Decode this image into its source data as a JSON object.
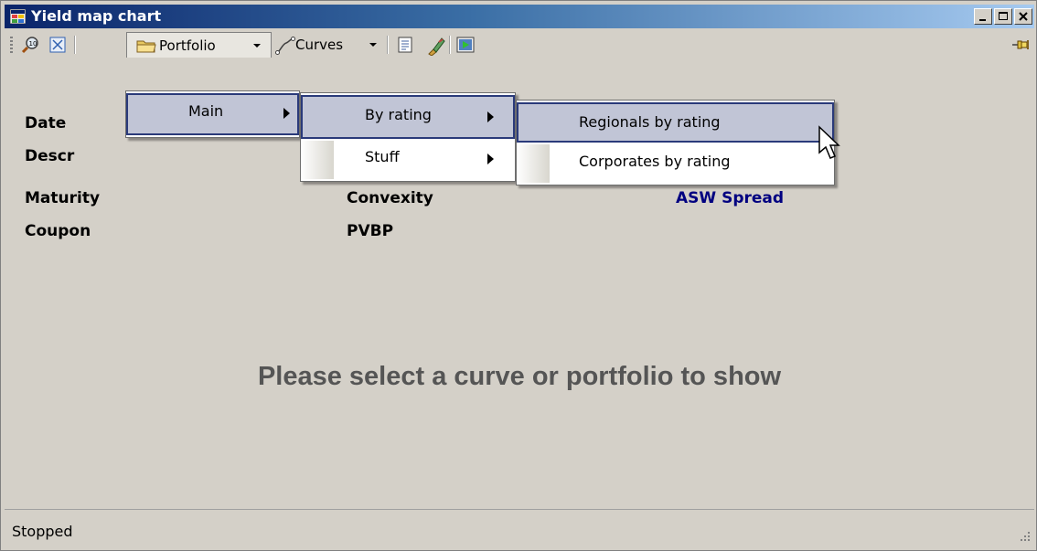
{
  "window": {
    "title": "Yield map chart",
    "minimize_icon": "minimize-icon",
    "maximize_icon": "maximize-icon",
    "close_icon": "close-icon"
  },
  "toolbar": {
    "zoom_icon": "zoom-icon",
    "fit_icon": "fit-icon",
    "portfolio_label": "Portfolio",
    "curves_label": "Curves",
    "report_icon": "report-icon",
    "brush_icon": "brush-icon",
    "run_icon": "play-icon",
    "pin_icon": "pin-icon"
  },
  "info": {
    "date": "Date",
    "descr": "Descr",
    "maturity": "Maturity",
    "coupon": "Coupon",
    "convexity": "Convexity",
    "pvbp": "PVBP",
    "asw_spread": "ASW Spread"
  },
  "placeholder": "Please select a curve or portfolio to show",
  "status": "Stopped",
  "menus": {
    "level1": [
      {
        "label": "Main"
      }
    ],
    "level2": [
      {
        "label": "By rating"
      },
      {
        "label": "Stuff"
      }
    ],
    "level3": [
      {
        "label": "Regionals by rating"
      },
      {
        "label": "Corporates by rating"
      }
    ]
  },
  "colors": {
    "title_start": "#0a246a",
    "title_end": "#a6caf0",
    "highlight": "#c1c5d6",
    "asw_blue": "#000080"
  }
}
